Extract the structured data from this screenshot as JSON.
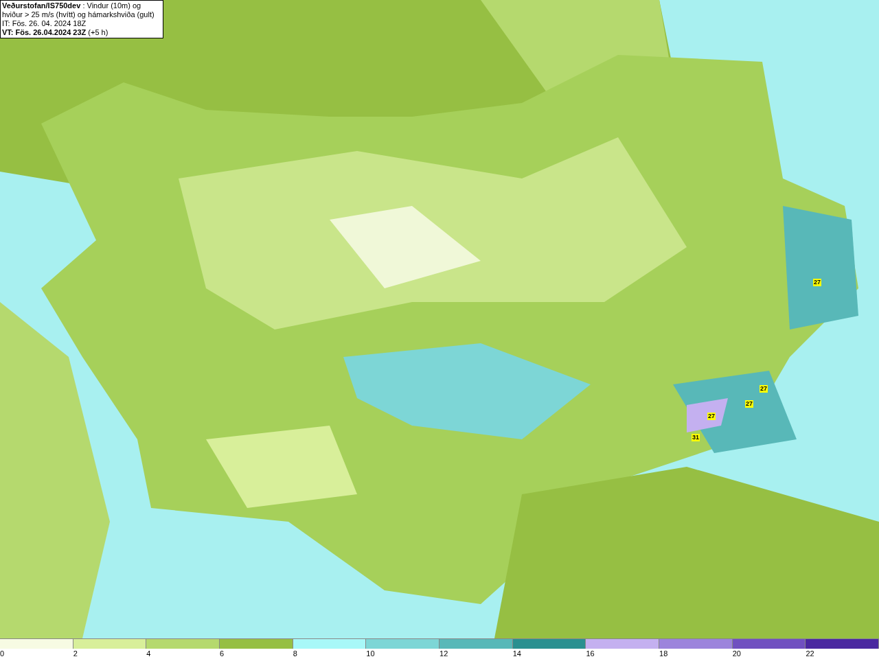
{
  "title_box": {
    "lines": [
      "**Veðurstofan/IS750dev** : Vindur (10m) og hviður > 25 m/s (hvítt) og hámarkshviða (gult)",
      "IT: Fös. 26. 04. 2024 18Z",
      "**VT: Fös. 26.04.2024 23Z** (+5 h)"
    ]
  },
  "gust_labels": [
    "27",
    "27",
    "27",
    "27",
    "31"
  ],
  "legend": [
    {
      "label": "0",
      "color": "#f7fbe3"
    },
    {
      "label": "2",
      "color": "#d8ef9a"
    },
    {
      "label": "4",
      "color": "#b5d96e"
    },
    {
      "label": "6",
      "color": "#96bf43"
    },
    {
      "label": "8",
      "color": "#a8f8f8"
    },
    {
      "label": "10",
      "color": "#7dd6d6"
    },
    {
      "label": "12",
      "color": "#58b8b8"
    },
    {
      "label": "14",
      "color": "#2a9090"
    },
    {
      "label": "16",
      "color": "#c4b0f0"
    },
    {
      "label": "18",
      "color": "#9c84dc"
    },
    {
      "label": "20",
      "color": "#7050c0"
    },
    {
      "label": "22",
      "color": "#4a28a0"
    }
  ]
}
